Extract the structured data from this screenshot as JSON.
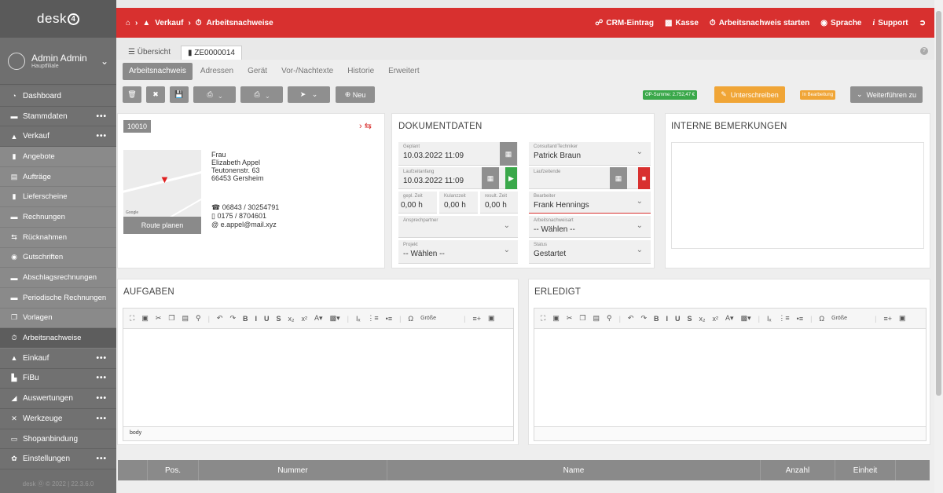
{
  "app": {
    "logo": "desk",
    "logo_badge": "4"
  },
  "user": {
    "name": "Admin Admin",
    "branch": "Hauptfiliale"
  },
  "nav": [
    {
      "label": "Dashboard",
      "icon": "gauge-icon",
      "type": "main"
    },
    {
      "label": "Stammdaten",
      "icon": "folder-icon",
      "type": "main",
      "dots": "•••"
    },
    {
      "label": "Verkauf",
      "icon": "cart-icon",
      "type": "main",
      "dots": "•••"
    },
    {
      "label": "Angebote",
      "icon": "document-icon",
      "type": "sub"
    },
    {
      "label": "Aufträge",
      "icon": "list-icon",
      "type": "sub"
    },
    {
      "label": "Lieferscheine",
      "icon": "file-icon",
      "type": "sub"
    },
    {
      "label": "Rechnungen",
      "icon": "invoice-icon",
      "type": "sub"
    },
    {
      "label": "Rücknahmen",
      "icon": "return-icon",
      "type": "sub"
    },
    {
      "label": "Gutschriften",
      "icon": "credit-icon",
      "type": "sub"
    },
    {
      "label": "Abschlagsrechnungen",
      "icon": "invoice-icon",
      "type": "sub"
    },
    {
      "label": "Periodische Rechnungen",
      "icon": "invoice-icon",
      "type": "sub"
    },
    {
      "label": "Vorlagen",
      "icon": "copy-icon",
      "type": "sub"
    },
    {
      "label": "Arbeitsnachweise",
      "icon": "stopwatch-icon",
      "type": "active"
    },
    {
      "label": "Einkauf",
      "icon": "cart-icon",
      "type": "main",
      "dots": "•••"
    },
    {
      "label": "FiBu",
      "icon": "book-icon",
      "type": "main",
      "dots": "•••"
    },
    {
      "label": "Auswertungen",
      "icon": "chart-icon",
      "type": "main",
      "dots": "•••"
    },
    {
      "label": "Werkzeuge",
      "icon": "tools-icon",
      "type": "main",
      "dots": "•••"
    },
    {
      "label": "Shopanbindung",
      "icon": "shop-icon",
      "type": "main"
    },
    {
      "label": "Einstellungen",
      "icon": "gear-icon",
      "type": "main",
      "dots": "•••"
    }
  ],
  "footer": "desk ⓪ © 2022 | 22.3.6.0",
  "topbar": {
    "bc1": "Verkauf",
    "bc2": "Arbeitsnachweise",
    "crm": "CRM-Eintrag",
    "kasse": "Kasse",
    "start": "Arbeitsnachweis starten",
    "sprache": "Sprache",
    "support": "Support"
  },
  "tabs": {
    "overview": "Übersicht",
    "doc": "ZE0000014"
  },
  "subtabs": [
    "Arbeitsnachweis",
    "Adressen",
    "Gerät",
    "Vor-/Nachtexte",
    "Historie",
    "Erweitert"
  ],
  "toolbar": {
    "neu": "Neu",
    "op": "OP-Summe: 2.752,47 €",
    "sign": "Unterschreiben",
    "status": "In Bearbeitung",
    "weiter": "Weiterführen zu"
  },
  "address": {
    "id": "10010",
    "salutation": "Frau",
    "name": "Elizabeth Appel",
    "street": "Teutonenstr. 63",
    "city": "66453 Gersheim",
    "phone": "06843 / 30254791",
    "mobile": "0175 / 8704601",
    "email": "e.appel@mail.xyz",
    "route": "Route planen",
    "map_attr": "Google"
  },
  "doc": {
    "title": "DOKUMENTDATEN",
    "geplant_l": "Geplant",
    "geplant": "10.03.2022 11:09",
    "start_l": "Laufzeitanfang",
    "start": "10.03.2022 11:09",
    "ende_l": "Laufzeitende",
    "gepl_l": "gepl. Zeit",
    "gepl": "0,00 h",
    "kulanz_l": "Kulanzzeit",
    "kulanz": "0,00 h",
    "result_l": "result. Zeit",
    "result": "0,00 h",
    "ansp_l": "Ansprechpartner",
    "projekt_l": "Projekt",
    "projekt": "-- Wählen --",
    "cons_l": "Consultant/Techniker",
    "cons": "Patrick Braun",
    "bearb_l": "Bearbeiter",
    "bearb": "Frank Hennings",
    "art_l": "Arbeitsnachweisart",
    "art": "-- Wählen --",
    "status_l": "Status",
    "status": "Gestartet"
  },
  "interne": "INTERNE BEMERKUNGEN",
  "aufgaben": "AUFGABEN",
  "erledigt": "ERLEDIGT",
  "editor_foot": "body",
  "groesse": "Größe",
  "table": {
    "cols": [
      "Pos.",
      "Nummer",
      "Name",
      "Anzahl",
      "Einheit"
    ]
  }
}
